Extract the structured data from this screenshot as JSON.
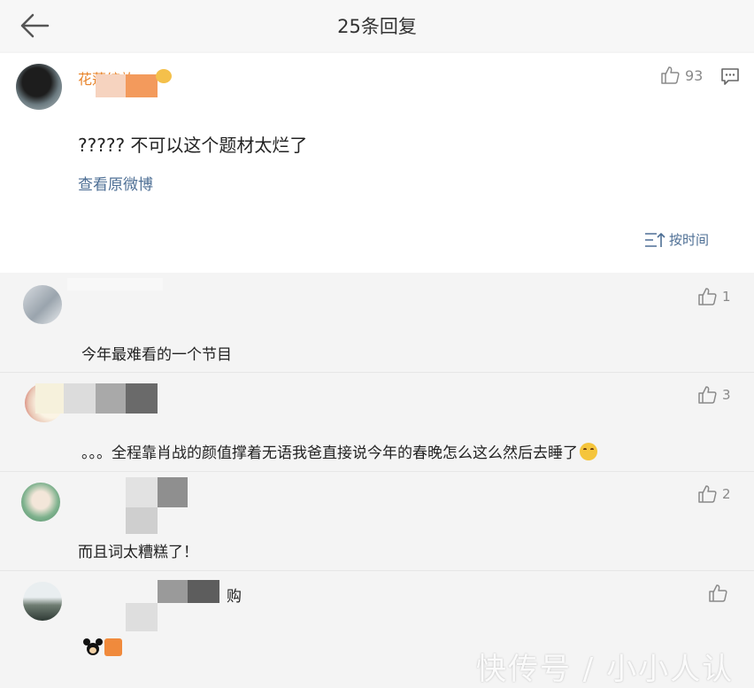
{
  "header": {
    "title": "25条回复"
  },
  "main_comment": {
    "username": "花莲绽放",
    "likes": "93",
    "text": "?????  不可以这个题材太烂了",
    "view_original": "查看原微博",
    "sort_label": "按时间"
  },
  "replies": [
    {
      "text": "今年最难看的一个节目",
      "likes": "1"
    },
    {
      "text": "。。。全程靠肖战的颜值撑着无语我爸直接说今年的春晚怎么这么然后去睡了",
      "likes": "3"
    },
    {
      "text": "而且词太糟糕了！",
      "likes": "2"
    },
    {
      "name_suffix": "购",
      "likes": ""
    }
  ],
  "watermark": "快传号 / 小小人认",
  "icons": {
    "back": "arrow-left-icon",
    "like": "thumbs-up-icon",
    "comment": "comment-icon",
    "sort": "sort-icon"
  },
  "colors": {
    "username": "#e8842a",
    "link": "#4e6f95",
    "background": "#f4f4f4",
    "card": "#ffffff"
  }
}
